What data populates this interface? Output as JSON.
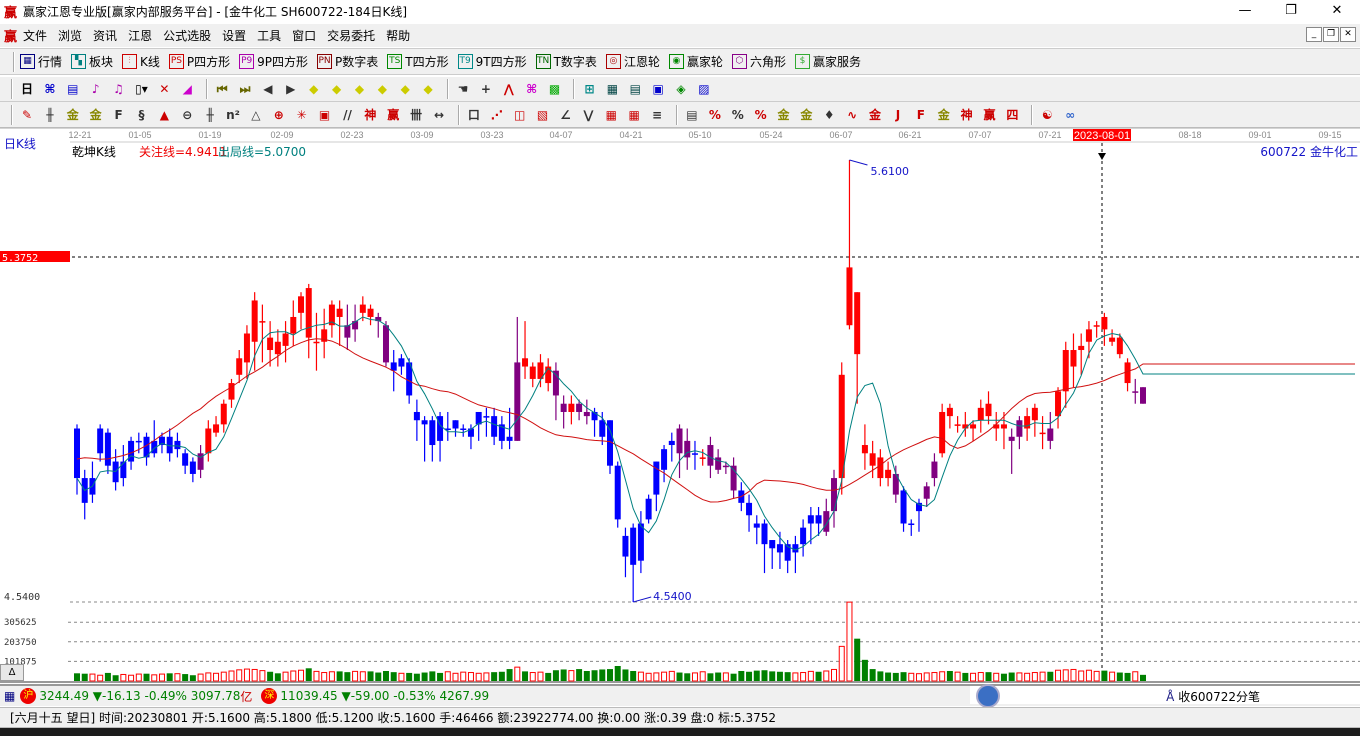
{
  "window": {
    "title": "赢家江恩专业版[赢家内部服务平台] - [金牛化工  SH600722-184日K线]",
    "logo": "赢",
    "minimize": "—",
    "restore": "❐",
    "close": "✕"
  },
  "menu": {
    "logo": "赢",
    "items": [
      "文件",
      "浏览",
      "资讯",
      "江恩",
      "公式选股",
      "设置",
      "工具",
      "窗口",
      "交易委托",
      "帮助"
    ],
    "mdi": [
      "_",
      "❐",
      "✕"
    ]
  },
  "toolbar1": [
    {
      "label": "行情",
      "icon": "table-icon",
      "glyph": "▦",
      "color": "#000080"
    },
    {
      "label": "板块",
      "icon": "blocks-icon",
      "glyph": "▚",
      "color": "#008080"
    },
    {
      "label": "K线",
      "icon": "kline-icon",
      "glyph": "⫶",
      "color": "#c00"
    },
    {
      "label": "P四方形",
      "icon": "ps-icon",
      "glyph": "PS",
      "color": "#c00"
    },
    {
      "label": "9P四方形",
      "icon": "p9-icon",
      "glyph": "P9",
      "color": "#a0a"
    },
    {
      "label": "P数字表",
      "icon": "pn-icon",
      "glyph": "PN",
      "color": "#800"
    },
    {
      "label": "T四方形",
      "icon": "ts-icon",
      "glyph": "TS",
      "color": "#080"
    },
    {
      "label": "9T四方形",
      "icon": "t9-icon",
      "glyph": "T9",
      "color": "#088"
    },
    {
      "label": "T数字表",
      "icon": "tn-icon",
      "glyph": "TN",
      "color": "#060"
    },
    {
      "label": "江恩轮",
      "icon": "gann-wheel-icon",
      "glyph": "◎",
      "color": "#a00"
    },
    {
      "label": "赢家轮",
      "icon": "winner-wheel-icon",
      "glyph": "◉",
      "color": "#080"
    },
    {
      "label": "六角形",
      "icon": "hexagon-icon",
      "glyph": "⬡",
      "color": "#808"
    },
    {
      "label": "赢家服务",
      "icon": "dollar-icon",
      "glyph": "$",
      "color": "#3a3"
    }
  ],
  "toolbar2": [
    [
      "period-select-icon",
      "日▾",
      "#000"
    ],
    [
      "zoom-in-icon",
      "⌘",
      "#00c"
    ],
    [
      "notes-icon",
      "▤",
      "#00c"
    ],
    [
      "indicator3-icon",
      "♪",
      "#a0a"
    ],
    [
      "indicator9-icon",
      "♫",
      "#a0a"
    ],
    [
      "candle-type-icon",
      "▯▾",
      "#000"
    ],
    [
      "formula-icon",
      "✕",
      "#c00"
    ],
    [
      "color-theme-icon",
      "◢",
      "#c0c"
    ],
    null,
    [
      "first-icon",
      "⏮",
      "#660"
    ],
    [
      "last-icon",
      "⏭",
      "#660"
    ],
    [
      "prev-icon",
      "◀",
      "#333"
    ],
    [
      "next-icon",
      "▶",
      "#333"
    ],
    [
      "shift-left-icon",
      "◆",
      "#cc0"
    ],
    [
      "shift-right-icon",
      "◆",
      "#cc0"
    ],
    [
      "expand-icon",
      "◆",
      "#cc0"
    ],
    [
      "shrink-icon",
      "◆",
      "#cc0"
    ],
    [
      "expand-v-icon",
      "◆",
      "#cc0"
    ],
    [
      "shrink-v-icon",
      "◆",
      "#cc0"
    ],
    null,
    [
      "hand-icon",
      "☚",
      "#333"
    ],
    [
      "crosshair-icon",
      "+",
      "#333"
    ],
    [
      "line-icon",
      "⋀",
      "#c00"
    ],
    [
      "pattern-icon",
      "⌘",
      "#c0c"
    ],
    [
      "grid-icon",
      "▩",
      "#0a0"
    ],
    null,
    [
      "calendar-icon",
      "⊞",
      "#088"
    ],
    [
      "calculator-icon",
      "▦",
      "#044"
    ],
    [
      "report-icon",
      "▤",
      "#044"
    ],
    [
      "save-icon",
      "▣",
      "#00c"
    ],
    [
      "web-icon",
      "◈",
      "#080"
    ],
    [
      "print-icon",
      "▨",
      "#00c"
    ]
  ],
  "toolbar3": [
    [
      "pen-icon",
      "✎",
      "#c00"
    ],
    [
      "parallel-icon",
      "╫",
      "#333"
    ],
    [
      "gold-icon",
      "金",
      "#880"
    ],
    [
      "gold2-icon",
      "金",
      "#880"
    ],
    [
      "fib-icon",
      "F",
      "#333"
    ],
    [
      "spiral-icon",
      "§",
      "#333"
    ],
    [
      "fan-icon",
      "▲",
      "#c00"
    ],
    [
      "circle-icon",
      "⊖",
      "#333"
    ],
    [
      "cycle-icon",
      "╫",
      "#333"
    ],
    [
      "n2-icon",
      "n²",
      "#333"
    ],
    [
      "angle-icon",
      "△",
      "#333"
    ],
    [
      "target-icon",
      "⊕",
      "#c00"
    ],
    [
      "web2-icon",
      "✳",
      "#c00"
    ],
    [
      "square-icon",
      "▣",
      "#c00"
    ],
    [
      "line2-icon",
      "//",
      "#333"
    ],
    [
      "shen-icon",
      "神",
      "#c00"
    ],
    [
      "ying-icon",
      "赢",
      "#c00"
    ],
    [
      "comb-icon",
      "卌",
      "#333"
    ],
    [
      "measure-icon",
      "↔",
      "#333"
    ],
    null,
    [
      "box-icon",
      "口",
      "#333"
    ],
    [
      "gann-fan-icon",
      "⋰",
      "#c00"
    ],
    [
      "gann-box-icon",
      "◫",
      "#c00"
    ],
    [
      "gann-grid-icon",
      "▧",
      "#c00"
    ],
    [
      "angle2-icon",
      "∠",
      "#333"
    ],
    [
      "zigzag-icon",
      "⋁",
      "#333"
    ],
    [
      "grid2-icon",
      "▦",
      "#c00"
    ],
    [
      "grid3-icon",
      "▦",
      "#c00"
    ],
    [
      "lines-icon",
      "≡",
      "#333"
    ],
    null,
    [
      "table2-icon",
      "▤",
      "#333"
    ],
    [
      "pct-red-icon",
      "%",
      "#c00"
    ],
    [
      "pct-icon",
      "%",
      "#333"
    ],
    [
      "pct-line-icon",
      "%",
      "#c00"
    ],
    [
      "gold-circle-icon",
      "金",
      "#880"
    ],
    [
      "gold-line-icon",
      "金",
      "#880"
    ],
    [
      "tools-icon",
      "♦",
      "#333"
    ],
    [
      "cycle2-icon",
      "∿",
      "#c00"
    ],
    [
      "gold-box-icon",
      "金",
      "#c00"
    ],
    [
      "j-icon",
      "J",
      "#c00"
    ],
    [
      "f-icon",
      "F",
      "#c00"
    ],
    [
      "gold3-icon",
      "金",
      "#880"
    ],
    [
      "shen2-icon",
      "神",
      "#c00"
    ],
    [
      "ying2-icon",
      "赢",
      "#c00"
    ],
    [
      "si-icon",
      "四",
      "#c00"
    ],
    null,
    [
      "taiji-icon",
      "☯",
      "#c00"
    ],
    [
      "infinity-icon",
      "∞",
      "#36c"
    ]
  ],
  "chart": {
    "period_label": "日K线",
    "indicator_name": "乾坤K线",
    "focus_line": "关注线=4.9411",
    "exit_line": "出局线=5.0700",
    "stock": "600722  金牛化工",
    "dates": [
      "12-21",
      "01-05",
      "01-19",
      "02-09",
      "02-23",
      "03-09",
      "03-23",
      "04-07",
      "04-21",
      "05-10",
      "05-24",
      "06-07",
      "06-21",
      "07-07",
      "07-21",
      "",
      "08-18",
      "09-01",
      "09-15"
    ],
    "cursor_date": "2023-08-01",
    "cursor_price": "5.3752",
    "high_label": "5.6100",
    "low_label": "4.5400",
    "axis_low": "4.5400",
    "vol_ticks": [
      "305625",
      "203750",
      "101875"
    ],
    "vol_tick_values": [
      305625,
      203750,
      101875
    ],
    "price_range": [
      4.54,
      5.61
    ],
    "colors": {
      "up": "#ff0000",
      "down": "#0000ff",
      "neutral": "#800080",
      "ma_short": "#008080",
      "ma_long": "#d01010",
      "vol_down": "#008000"
    },
    "candle_colors": "bbbbbbbbbbbbbbbbprrrrrrrrrrrrrrrrrrpprrppbbbbbbbbbbbbbbbbprrrrpprppbbbbbbbbbbbppbrppppbbbbbbbbbbbpprrrrrrrpbbbpprrrrrrrrrpprrrprrrrrrrrrrpp",
    "candles": [
      [
        4.96,
        4.84,
        4.97,
        4.8
      ],
      [
        4.84,
        4.78,
        4.86,
        4.74
      ],
      [
        4.8,
        4.84,
        4.88,
        4.78
      ],
      [
        4.9,
        4.96,
        4.97,
        4.88
      ],
      [
        4.95,
        4.87,
        4.96,
        4.85
      ],
      [
        4.88,
        4.83,
        4.91,
        4.81
      ],
      [
        4.84,
        4.88,
        4.92,
        4.82
      ],
      [
        4.88,
        4.93,
        4.94,
        4.86
      ],
      [
        4.93,
        4.93,
        4.95,
        4.9
      ],
      [
        4.94,
        4.89,
        4.95,
        4.87
      ],
      [
        4.9,
        4.93,
        4.98,
        4.89
      ],
      [
        4.92,
        4.94,
        4.95,
        4.9
      ],
      [
        4.94,
        4.9,
        4.96,
        4.88
      ],
      [
        4.91,
        4.93,
        4.95,
        4.89
      ],
      [
        4.9,
        4.87,
        4.91,
        4.85
      ],
      [
        4.88,
        4.85,
        4.89,
        4.83
      ],
      [
        4.86,
        4.9,
        4.92,
        4.84
      ],
      [
        4.9,
        4.96,
        4.98,
        4.88
      ],
      [
        4.95,
        4.97,
        4.99,
        4.94
      ],
      [
        4.97,
        5.02,
        5.03,
        4.95
      ],
      [
        5.03,
        5.07,
        5.08,
        5.01
      ],
      [
        5.09,
        5.13,
        5.15,
        5.07
      ],
      [
        5.12,
        5.19,
        5.21,
        5.08
      ],
      [
        5.17,
        5.27,
        5.29,
        5.1
      ],
      [
        5.22,
        5.22,
        5.26,
        5.12
      ],
      [
        5.18,
        5.15,
        5.22,
        5.11
      ],
      [
        5.17,
        5.14,
        5.2,
        5.11
      ],
      [
        5.16,
        5.19,
        5.22,
        5.12
      ],
      [
        5.19,
        5.23,
        5.27,
        5.16
      ],
      [
        5.24,
        5.28,
        5.29,
        5.2
      ],
      [
        5.3,
        5.18,
        5.31,
        5.13
      ],
      [
        5.17,
        5.17,
        5.24,
        5.1
      ],
      [
        5.17,
        5.2,
        5.25,
        5.13
      ],
      [
        5.21,
        5.26,
        5.27,
        5.18
      ],
      [
        5.25,
        5.23,
        5.27,
        5.16
      ],
      [
        5.21,
        5.18,
        5.26,
        5.15
      ],
      [
        5.2,
        5.22,
        5.26,
        5.17
      ],
      [
        5.24,
        5.26,
        5.28,
        5.22
      ],
      [
        5.25,
        5.23,
        5.26,
        5.21
      ],
      [
        5.23,
        5.22,
        5.24,
        5.18
      ],
      [
        5.21,
        5.12,
        5.22,
        5.11
      ],
      [
        5.12,
        5.1,
        5.15,
        5.05
      ],
      [
        5.11,
        5.13,
        5.14,
        5.09
      ],
      [
        5.12,
        5.04,
        5.13,
        5.02
      ],
      [
        5.0,
        4.98,
        5.03,
        4.93
      ],
      [
        4.98,
        4.97,
        4.99,
        4.88
      ],
      [
        4.98,
        4.92,
        4.99,
        4.88
      ],
      [
        4.99,
        4.93,
        5.0,
        4.88
      ],
      [
        4.96,
        4.96,
        5.0,
        4.93
      ],
      [
        4.96,
        4.98,
        4.98,
        4.94
      ],
      [
        4.96,
        4.96,
        4.97,
        4.94
      ],
      [
        4.94,
        4.96,
        4.97,
        4.91
      ],
      [
        4.97,
        5.0,
        5.0,
        4.93
      ],
      [
        4.99,
        4.99,
        5.01,
        4.94
      ],
      [
        4.99,
        4.94,
        5.01,
        4.92
      ],
      [
        4.97,
        4.93,
        4.99,
        4.91
      ],
      [
        4.94,
        4.93,
        5.01,
        4.91
      ],
      [
        4.93,
        5.12,
        5.23,
        4.93
      ],
      [
        5.13,
        5.11,
        5.22,
        5.08
      ],
      [
        5.08,
        5.11,
        5.12,
        5.06
      ],
      [
        5.08,
        5.12,
        5.14,
        5.06
      ],
      [
        5.11,
        5.07,
        5.13,
        5.05
      ],
      [
        5.1,
        5.04,
        5.12,
        4.98
      ],
      [
        5.02,
        5.0,
        5.04,
        4.96
      ],
      [
        5.0,
        5.02,
        5.04,
        4.97
      ],
      [
        5.02,
        5.0,
        5.03,
        4.98
      ],
      [
        5.0,
        4.99,
        5.03,
        4.97
      ],
      [
        5.0,
        4.98,
        5.01,
        4.94
      ],
      [
        4.98,
        4.94,
        5.0,
        4.92
      ],
      [
        4.98,
        4.87,
        4.98,
        4.85
      ],
      [
        4.87,
        4.74,
        4.88,
        4.72
      ],
      [
        4.7,
        4.65,
        4.72,
        4.6
      ],
      [
        4.72,
        4.63,
        4.73,
        4.54
      ],
      [
        4.64,
        4.73,
        4.76,
        4.61
      ],
      [
        4.74,
        4.79,
        4.8,
        4.73
      ],
      [
        4.8,
        4.88,
        4.88,
        4.76
      ],
      [
        4.86,
        4.91,
        4.92,
        4.83
      ],
      [
        4.92,
        4.93,
        4.95,
        4.88
      ],
      [
        4.96,
        4.9,
        4.97,
        4.84
      ],
      [
        4.93,
        4.89,
        4.96,
        4.86
      ],
      [
        4.9,
        4.9,
        4.93,
        4.86
      ],
      [
        4.89,
        4.89,
        4.91,
        4.87
      ],
      [
        4.92,
        4.87,
        4.94,
        4.84
      ],
      [
        4.89,
        4.86,
        4.91,
        4.85
      ],
      [
        4.87,
        4.87,
        4.88,
        4.85
      ],
      [
        4.87,
        4.81,
        4.89,
        4.79
      ],
      [
        4.81,
        4.78,
        4.83,
        4.76
      ],
      [
        4.78,
        4.75,
        4.8,
        4.71
      ],
      [
        4.73,
        4.72,
        4.75,
        4.68
      ],
      [
        4.73,
        4.68,
        4.74,
        4.61
      ],
      [
        4.69,
        4.67,
        4.69,
        4.62
      ],
      [
        4.68,
        4.66,
        4.71,
        4.62
      ],
      [
        4.68,
        4.64,
        4.69,
        4.61
      ],
      [
        4.66,
        4.68,
        4.7,
        4.61
      ],
      [
        4.68,
        4.72,
        4.74,
        4.65
      ],
      [
        4.73,
        4.75,
        4.77,
        4.68
      ],
      [
        4.75,
        4.73,
        4.77,
        4.7
      ],
      [
        4.71,
        4.76,
        4.79,
        4.7
      ],
      [
        4.76,
        4.84,
        4.86,
        4.72
      ],
      [
        4.84,
        5.09,
        5.12,
        4.8
      ],
      [
        5.21,
        5.35,
        5.61,
        5.2
      ],
      [
        5.29,
        5.14,
        5.29,
        5.02
      ],
      [
        4.92,
        4.9,
        4.97,
        4.86
      ],
      [
        4.9,
        4.87,
        4.93,
        4.84
      ],
      [
        4.89,
        4.84,
        4.91,
        4.82
      ],
      [
        4.86,
        4.84,
        4.88,
        4.82
      ],
      [
        4.85,
        4.8,
        4.87,
        4.78
      ],
      [
        4.81,
        4.73,
        4.82,
        4.71
      ],
      [
        4.73,
        4.73,
        4.74,
        4.7
      ],
      [
        4.76,
        4.78,
        4.79,
        4.71
      ],
      [
        4.79,
        4.82,
        4.83,
        4.77
      ],
      [
        4.84,
        4.88,
        4.9,
        4.82
      ],
      [
        4.9,
        5.0,
        5.02,
        4.89
      ],
      [
        5.01,
        4.99,
        5.02,
        4.96
      ],
      [
        4.97,
        4.97,
        4.99,
        4.95
      ],
      [
        4.97,
        4.96,
        5.0,
        4.94
      ],
      [
        4.96,
        4.97,
        4.98,
        4.93
      ],
      [
        4.98,
        5.01,
        5.03,
        4.95
      ],
      [
        5.02,
        4.99,
        5.05,
        4.97
      ],
      [
        4.96,
        4.97,
        5.0,
        4.93
      ],
      [
        4.97,
        4.96,
        5.0,
        4.91
      ],
      [
        4.94,
        4.93,
        4.96,
        4.85
      ],
      [
        4.94,
        4.98,
        4.99,
        4.91
      ],
      [
        4.96,
        4.99,
        5.01,
        4.93
      ],
      [
        4.98,
        5.01,
        5.02,
        4.94
      ],
      [
        4.95,
        4.95,
        4.99,
        4.91
      ],
      [
        4.96,
        4.93,
        5.0,
        4.91
      ],
      [
        4.99,
        5.05,
        5.06,
        4.96
      ],
      [
        5.05,
        5.15,
        5.17,
        5.01
      ],
      [
        5.11,
        5.15,
        5.19,
        5.06
      ],
      [
        5.15,
        5.16,
        5.19,
        5.09
      ],
      [
        5.17,
        5.2,
        5.22,
        5.13
      ],
      [
        5.21,
        5.21,
        5.22,
        5.18
      ],
      [
        5.23,
        5.2,
        5.24,
        5.16
      ],
      [
        5.17,
        5.18,
        5.2,
        5.16
      ],
      [
        5.18,
        5.14,
        5.19,
        5.13
      ],
      [
        5.12,
        5.07,
        5.13,
        5.05
      ],
      [
        5.05,
        5.05,
        5.08,
        5.02
      ],
      [
        5.06,
        5.02,
        5.06,
        5.02
      ]
    ],
    "volumes": [
      40000,
      38000,
      36000,
      30000,
      42000,
      30000,
      34000,
      30000,
      36000,
      38000,
      32000,
      36000,
      40000,
      38000,
      36000,
      30000,
      36000,
      42000,
      40000,
      46000,
      52000,
      58000,
      62000,
      60000,
      54000,
      48000,
      40000,
      46000,
      52000,
      56000,
      66000,
      50000,
      44000,
      48000,
      50000,
      46000,
      50000,
      48000,
      50000,
      44000,
      52000,
      46000,
      40000,
      42000,
      38000,
      44000,
      50000,
      42000,
      48000,
      40000,
      46000,
      44000,
      40000,
      42000,
      46000,
      48000,
      62000,
      72000,
      50000,
      44000,
      46000,
      42000,
      56000,
      60000,
      54000,
      62000,
      52000,
      56000,
      60000,
      62000,
      78000,
      60000,
      52000,
      46000,
      40000,
      42000,
      46000,
      50000,
      44000,
      40000,
      42000,
      48000,
      40000,
      44000,
      42000,
      38000,
      52000,
      48000,
      54000,
      56000,
      50000,
      48000,
      46000,
      42000,
      44000,
      50000,
      48000,
      52000,
      60000,
      180000,
      410000,
      220000,
      110000,
      62000,
      50000,
      44000,
      42000,
      46000,
      40000,
      38000,
      42000,
      44000,
      48000,
      52000,
      46000,
      42000,
      40000,
      44000,
      46000,
      40000,
      38000,
      44000,
      42000,
      40000,
      44000,
      46000,
      48000,
      56000,
      58000,
      60000,
      52000,
      56000,
      50000,
      54000,
      46000,
      44000,
      42000,
      48000,
      32000
    ]
  },
  "scroll": {
    "delta": "Δ"
  },
  "status": {
    "sh_badge": "沪",
    "sh_text": "3244.49 ▼-16.13 -0.49% 3097.78",
    "sh_unit": "亿",
    "sz_badge": "深",
    "sz_text": "11039.45 ▼-59.00 -0.53% 4267.99",
    "fenbi": "收600722分笔"
  },
  "info": "[六月十五  望日] 时间:20230801 开:5.1600 高:5.1800 低:5.1200 收:5.1600 手:46466 额:23922774.00 换:0.00 涨:0.39 盘:0 标:5.3752"
}
